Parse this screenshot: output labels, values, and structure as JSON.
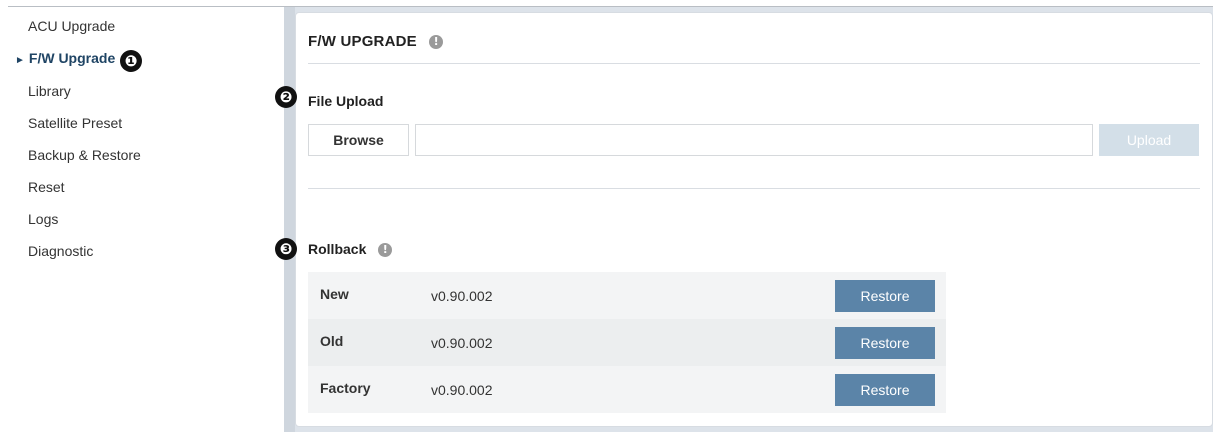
{
  "sidebar": {
    "items": [
      {
        "label": "ACU Upgrade",
        "active": false
      },
      {
        "label": "F/W Upgrade",
        "active": true
      },
      {
        "label": "Library",
        "active": false
      },
      {
        "label": "Satellite Preset",
        "active": false
      },
      {
        "label": "Backup & Restore",
        "active": false
      },
      {
        "label": "Reset",
        "active": false
      },
      {
        "label": "Logs",
        "active": false
      },
      {
        "label": "Diagnostic",
        "active": false
      }
    ],
    "active_arrow": "►"
  },
  "callouts": [
    "❶",
    "❷",
    "❸"
  ],
  "panel": {
    "title": "F/W UPGRADE",
    "info_glyph": "!"
  },
  "file_upload": {
    "title": "File Upload",
    "browse_label": "Browse",
    "file_value": "",
    "upload_label": "Upload"
  },
  "rollback": {
    "title": "Rollback",
    "rows": [
      {
        "name": "New",
        "version": "v0.90.002",
        "action": "Restore"
      },
      {
        "name": "Old",
        "version": "v0.90.002",
        "action": "Restore"
      },
      {
        "name": "Factory",
        "version": "v0.90.002",
        "action": "Restore"
      }
    ]
  },
  "colors": {
    "accent": "#5b84a8",
    "disabled_button": "#d3dfe8",
    "active_nav": "#1f4464",
    "row_shade": "#f3f4f5"
  }
}
